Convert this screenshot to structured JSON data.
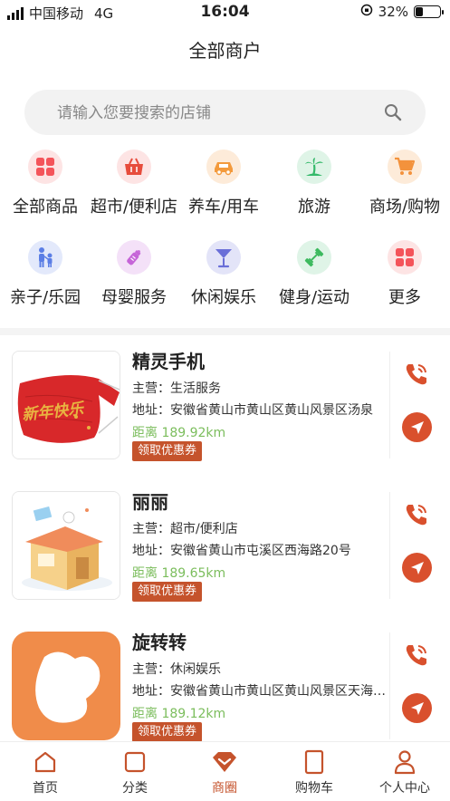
{
  "status": {
    "carrier": "中国移动",
    "network": "4G",
    "time": "16:04",
    "battery": "32%",
    "battery_level": 0.32
  },
  "page": {
    "title": "全部商户"
  },
  "search": {
    "placeholder": "请输入您要搜索的店铺"
  },
  "categories": [
    {
      "label": "全部商品",
      "icon": "grid-icon",
      "color": "#f4545a"
    },
    {
      "label": "超市/便利店",
      "icon": "basket-icon",
      "color": "#e74c3c"
    },
    {
      "label": "养车/用车",
      "icon": "car-icon",
      "color": "#f39a3c"
    },
    {
      "label": "旅游",
      "icon": "palm-tree-icon",
      "color": "#34b96a"
    },
    {
      "label": "商场/购物",
      "icon": "cart-icon",
      "color": "#f3923c"
    },
    {
      "label": "亲子/乐园",
      "icon": "parent-child-icon",
      "color": "#5b7ee5"
    },
    {
      "label": "母婴服务",
      "icon": "baby-bottle-icon",
      "color": "#c665d8"
    },
    {
      "label": "休闲娱乐",
      "icon": "cocktail-icon",
      "color": "#6a6fd8"
    },
    {
      "label": "健身/运动",
      "icon": "dumbbell-icon",
      "color": "#3cb95e"
    },
    {
      "label": "更多",
      "icon": "more-grid-icon",
      "color": "#f4545a"
    }
  ],
  "merchants": [
    {
      "name": "精灵手机",
      "business": "主营：生活服务",
      "address": "地址：安徽省黄山市黄山区黄山风景区汤泉",
      "distance": "距离 189.92km",
      "coupon": "领取优惠券",
      "thumb_text": "新年快乐"
    },
    {
      "name": "丽丽",
      "business": "主营：超市/便利店",
      "address": "地址：安徽省黄山市屯溪区西海路20号",
      "distance": "距离 189.65km",
      "coupon": "领取优惠券"
    },
    {
      "name": "旋转转",
      "business": "主营：休闲娱乐",
      "address": "地址：安徽省黄山市黄山区黄山风景区天海景区(…",
      "distance": "距离 189.12km",
      "coupon": "领取优惠券"
    }
  ],
  "tabs": [
    {
      "label": "首页",
      "icon": "home-icon"
    },
    {
      "label": "分类",
      "icon": "category-icon"
    },
    {
      "label": "商圈",
      "icon": "diamond-icon",
      "active": true
    },
    {
      "label": "购物车",
      "icon": "cart-tab-icon"
    },
    {
      "label": "个人中心",
      "icon": "person-icon"
    }
  ],
  "colors": {
    "accent": "#c5532c",
    "nav_button": "#d9502d",
    "distance": "#7bbd5c"
  }
}
